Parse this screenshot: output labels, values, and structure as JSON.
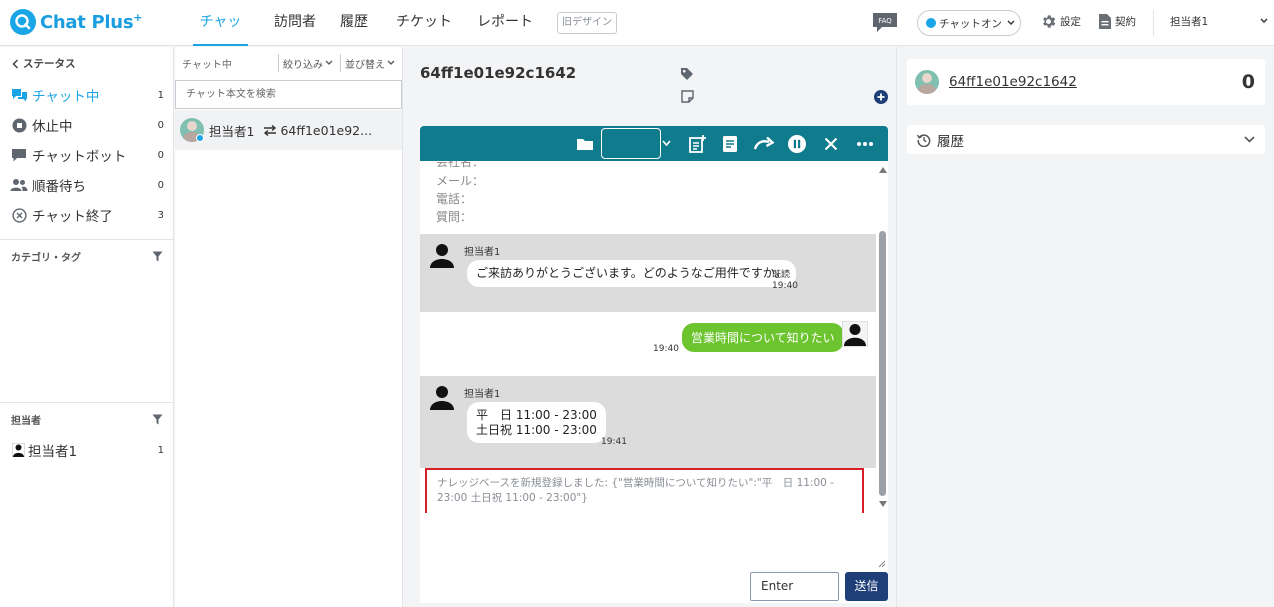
{
  "header": {
    "logo_text": "Chat Plus",
    "logo_sup": "+",
    "nav": [
      {
        "label": "チャット"
      },
      {
        "label": "訪問者"
      },
      {
        "label": "履歴"
      },
      {
        "label": "チケット"
      },
      {
        "label": "レポート"
      }
    ],
    "old_design": "旧デザイン",
    "faq": "FAQ",
    "chat_status": "チャットオン",
    "settings": "設定",
    "contract": "契約",
    "user": "担当者1",
    "accent": "#1aa6e6"
  },
  "sidebar": {
    "status_title": "ステータス",
    "items": [
      {
        "label": "チャット中",
        "count": "1",
        "icon": "chat-bubbles-icon"
      },
      {
        "label": "休止中",
        "count": "0",
        "icon": "pause-circle-icon"
      },
      {
        "label": "チャットボット",
        "count": "0",
        "icon": "chatbot-icon"
      },
      {
        "label": "順番待ち",
        "count": "0",
        "icon": "users-icon"
      },
      {
        "label": "チャット終了",
        "count": "3",
        "icon": "close-circle-icon"
      }
    ],
    "category_title": "カテゴリ・タグ",
    "agent_title": "担当者",
    "agents": [
      {
        "label": "担当者1",
        "count": "1"
      }
    ]
  },
  "chat_list": {
    "status_label": "チャット中",
    "filter_label": "絞り込み",
    "sort_label": "並び替え",
    "search_placeholder": "チャット本文を検索",
    "rows": [
      {
        "agent": "担当者1",
        "visitor": "64ff1e01e92..."
      }
    ]
  },
  "chat": {
    "id": "64ff1e01e92c1642",
    "form_fields": [
      "会社名：",
      "メール：",
      "電話：",
      "質問："
    ],
    "messages": [
      {
        "from": "担当者1",
        "text": "ご来訪ありがとうございます。どのようなご用件ですか。",
        "read": "既読",
        "time": "19:40"
      },
      {
        "from": "visitor",
        "text": "営業時間について知りたい",
        "time": "19:40"
      },
      {
        "from": "担当者1",
        "lines": [
          "平　日 11:00 - 23:00",
          "土日祝 11:00 - 23:00"
        ],
        "time": "19:41"
      }
    ],
    "kb_notice": "ナレッジベースを新規登録しました: {\"営業時間について知りたい\":\"平　日 11:00 - 23:00 土日祝 11:00 - 23:00\"}",
    "enter_label": "Enter",
    "send_label": "送信",
    "toolbar_color": "#0f7b8c",
    "visitor_bubble_color": "#6cc42f"
  },
  "visitor_panel": {
    "id": "64ff1e01e92c1642",
    "count": "0",
    "history_label": "履歴"
  }
}
